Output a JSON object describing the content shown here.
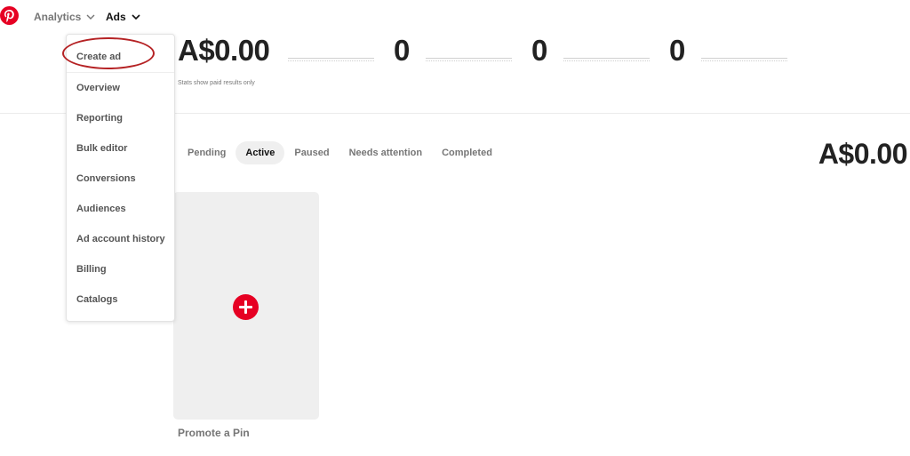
{
  "nav": {
    "analytics_label": "Analytics",
    "ads_label": "Ads"
  },
  "stats": {
    "spend": "A$0.00",
    "metric_2": "0",
    "metric_3": "0",
    "metric_4": "0",
    "note": "Stats show paid results only"
  },
  "tabs": [
    {
      "label": "Pending"
    },
    {
      "label": "Active"
    },
    {
      "label": "Paused"
    },
    {
      "label": "Needs attention"
    },
    {
      "label": "Completed"
    }
  ],
  "total_spend": "A$0.00",
  "promote": {
    "label": "Promote a Pin"
  },
  "menu": {
    "items": [
      {
        "label": "Create ad"
      },
      {
        "label": "Overview"
      },
      {
        "label": "Reporting"
      },
      {
        "label": "Bulk editor"
      },
      {
        "label": "Conversions"
      },
      {
        "label": "Audiences"
      },
      {
        "label": "Ad account history"
      },
      {
        "label": "Billing"
      },
      {
        "label": "Catalogs"
      }
    ]
  },
  "colors": {
    "brand_red": "#e60023",
    "annotation_red": "#b52224"
  },
  "icons": {
    "logo": "pinterest-logo-icon",
    "analytics_chevron": "chevron-down-icon",
    "ads_chevron": "chevron-down-icon",
    "promote": "plus-circle-icon"
  }
}
